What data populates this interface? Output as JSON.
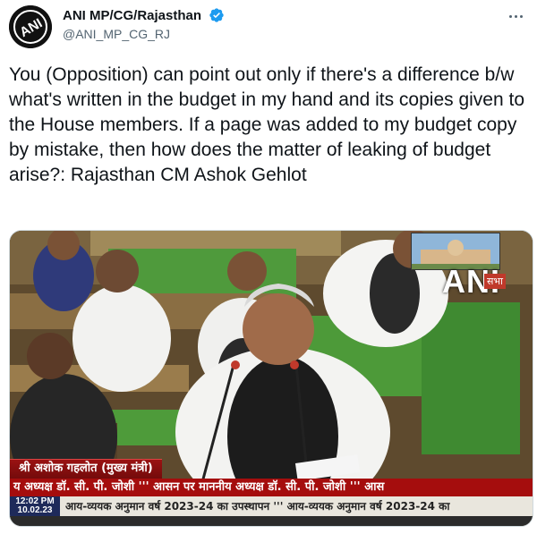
{
  "tweet": {
    "display_name": "ANI MP/CG/Rajasthan",
    "handle": "@ANI_MP_CG_RJ",
    "avatar_text": "ANI",
    "text": "You (Opposition) can point out only if there's a difference b/w what's written in the budget in my hand and its copies given to the House members. If a page was added to my budget copy by mistake, then how does the matter of leaking of budget arise?: Rajasthan CM Ashok Gehlot"
  },
  "video": {
    "logo": "ANI",
    "inset_label": "सभा",
    "nameplate": "श्री अशोक गहलोत (मुख्य मंत्री)",
    "ticker_top": "य अध्यक्ष डॉ. सी. पी. जोशी ''' आसन पर माननीय अध्यक्ष डॉ. सी. पी. जोशी ''' आस",
    "clock_time": "12:02 PM",
    "clock_date": "10.02.23",
    "ticker_bottom": "आय-व्ययक अनुमान वर्ष 2023-24 का उपस्थापन ''' आय-व्ययक अनुमान वर्ष 2023-24 का"
  },
  "colors": {
    "verified_blue": "#1d9bf0",
    "ticker_red": "#a50d0d",
    "bench_green": "#4c9a3a"
  },
  "icons": [
    "verified-badge-icon",
    "more-options-icon"
  ]
}
